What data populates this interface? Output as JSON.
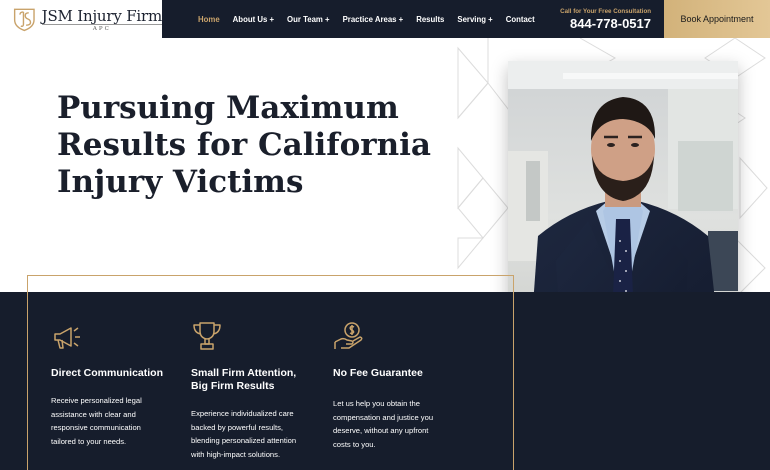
{
  "header": {
    "logo_name": "JSM Injury Firm",
    "logo_sub": "APC",
    "nav": [
      {
        "label": "Home"
      },
      {
        "label": "About Us +"
      },
      {
        "label": "Our Team +"
      },
      {
        "label": "Practice Areas +"
      },
      {
        "label": "Results"
      },
      {
        "label": "Serving +"
      },
      {
        "label": "Contact"
      }
    ],
    "contact_label": "Call for Your Free Consultation",
    "phone": "844-778-0517",
    "book_label": "Book Appointment"
  },
  "hero": {
    "title": "Pursuing Maximum Results for California Injury Victims"
  },
  "features": [
    {
      "icon": "megaphone-icon",
      "title": "Direct Communication",
      "desc": "Receive personalized legal assistance with clear and responsive communication tailored to your needs."
    },
    {
      "icon": "trophy-icon",
      "title": "Small Firm Attention, Big Firm Results",
      "desc": "Experience individualized care backed by powerful results, blending personalized attention with high-impact solutions."
    },
    {
      "icon": "hand-dollar-icon",
      "title": "No Fee Guarantee",
      "desc": "Let us help you obtain the compensation and justice you deserve, without any upfront costs to you."
    }
  ],
  "colors": {
    "navy": "#161d2c",
    "gold": "#c9a36b",
    "text_dark": "#1a1f2b"
  }
}
